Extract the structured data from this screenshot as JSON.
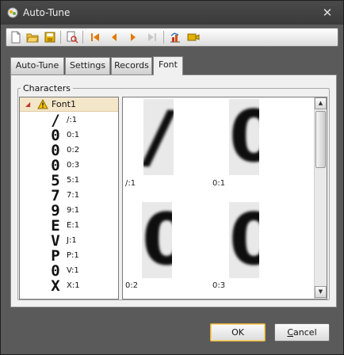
{
  "window": {
    "title": "Auto-Tune"
  },
  "toolbar": {
    "buttons": [
      {
        "icon": "new-document-icon"
      },
      {
        "icon": "open-folder-icon"
      },
      {
        "icon": "save-icon"
      },
      {
        "icon": "print-preview-icon"
      },
      {
        "icon": "first-icon"
      },
      {
        "icon": "previous-icon"
      },
      {
        "icon": "next-icon"
      },
      {
        "icon": "last-icon"
      },
      {
        "icon": "chart-icon"
      },
      {
        "icon": "camera-icon"
      }
    ]
  },
  "tabs": [
    {
      "label": "Auto-Tune",
      "active": false
    },
    {
      "label": "Settings",
      "active": false
    },
    {
      "label": "Records",
      "active": false
    },
    {
      "label": "Font",
      "active": true
    }
  ],
  "characters": {
    "group_title": "Characters",
    "root": {
      "label": "Font1",
      "icon": "warning-icon",
      "expanded": true
    },
    "items": [
      {
        "glyph": "/",
        "label": "/:1"
      },
      {
        "glyph": "0",
        "label": "0:1"
      },
      {
        "glyph": "0",
        "label": "0:2"
      },
      {
        "glyph": "0",
        "label": "0:3"
      },
      {
        "glyph": "5",
        "label": "5:1"
      },
      {
        "glyph": "7",
        "label": "7:1"
      },
      {
        "glyph": "9",
        "label": "9:1"
      },
      {
        "glyph": "E",
        "label": "E:1"
      },
      {
        "glyph": "V",
        "label": "J:1"
      },
      {
        "glyph": "P",
        "label": "P:1"
      },
      {
        "glyph": "0",
        "label": "V:1"
      },
      {
        "glyph": "X",
        "label": "X:1"
      }
    ]
  },
  "preview": {
    "samples": [
      {
        "glyph": "/",
        "label": "/:1"
      },
      {
        "glyph": "0",
        "label": "0:1"
      },
      {
        "glyph": "0",
        "label": "0:2"
      },
      {
        "glyph": "0",
        "label": "0:3"
      }
    ]
  },
  "buttons": {
    "ok": "OK",
    "cancel_prefix": "",
    "cancel_mnemonic": "C",
    "cancel_rest": "ancel"
  },
  "colors": {
    "window_bg": "#5a5a5a",
    "titlebar": "#3f3f3f",
    "selected_tree_row": "#f4e6c9",
    "default_button_border": "#e0b040"
  }
}
